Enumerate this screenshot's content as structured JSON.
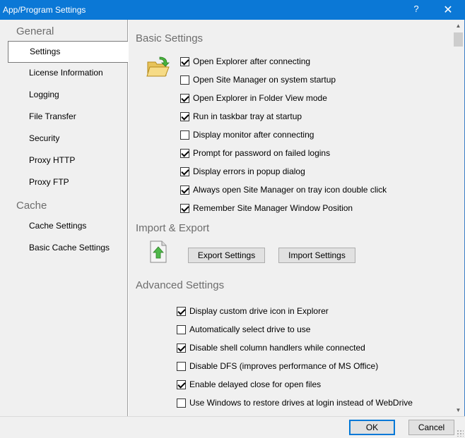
{
  "window": {
    "title": "App/Program Settings",
    "help_label": "?",
    "close_label": "✕"
  },
  "sidebar": {
    "groups": [
      {
        "label": "General"
      },
      {
        "label": "Cache"
      }
    ],
    "items": [
      {
        "label": "Settings",
        "selected": true
      },
      {
        "label": "License Information"
      },
      {
        "label": "Logging"
      },
      {
        "label": "File Transfer"
      },
      {
        "label": "Security"
      },
      {
        "label": "Proxy HTTP"
      },
      {
        "label": "Proxy FTP"
      },
      {
        "label": "Cache Settings"
      },
      {
        "label": "Basic Cache Settings"
      }
    ]
  },
  "basic": {
    "title": "Basic Settings",
    "icon": "open-folder-icon",
    "options": [
      {
        "label": "Open Explorer after connecting",
        "checked": true
      },
      {
        "label": "Open Site Manager on system startup",
        "checked": false
      },
      {
        "label": "Open Explorer in Folder View mode",
        "checked": true
      },
      {
        "label": "Run in taskbar tray at startup",
        "checked": true
      },
      {
        "label": "Display monitor after connecting",
        "checked": false
      },
      {
        "label": "Prompt for password on failed logins",
        "checked": true
      },
      {
        "label": "Display errors in popup dialog",
        "checked": true
      },
      {
        "label": "Always open Site Manager on tray icon double click",
        "checked": true
      },
      {
        "label": "Remember Site Manager Window Position",
        "checked": true
      }
    ]
  },
  "import_export": {
    "title": "Import & Export",
    "icon": "export-file-icon",
    "export_label": "Export Settings",
    "import_label": "Import Settings"
  },
  "advanced": {
    "title": "Advanced Settings",
    "options": [
      {
        "label": "Display custom drive icon in Explorer",
        "checked": true
      },
      {
        "label": "Automatically select drive to use",
        "checked": false
      },
      {
        "label": "Disable shell column handlers while connected",
        "checked": true
      },
      {
        "label": "Disable DFS (improves performance of MS Office)",
        "checked": false
      },
      {
        "label": "Enable delayed close for open files",
        "checked": true
      },
      {
        "label": "Use Windows to restore drives at login instead of WebDrive",
        "checked": false
      }
    ]
  },
  "footer": {
    "ok_label": "OK",
    "cancel_label": "Cancel"
  },
  "colors": {
    "titlebar": "#0b78d6",
    "panel": "#f0f0f0",
    "group_text": "#6d6d6d"
  }
}
